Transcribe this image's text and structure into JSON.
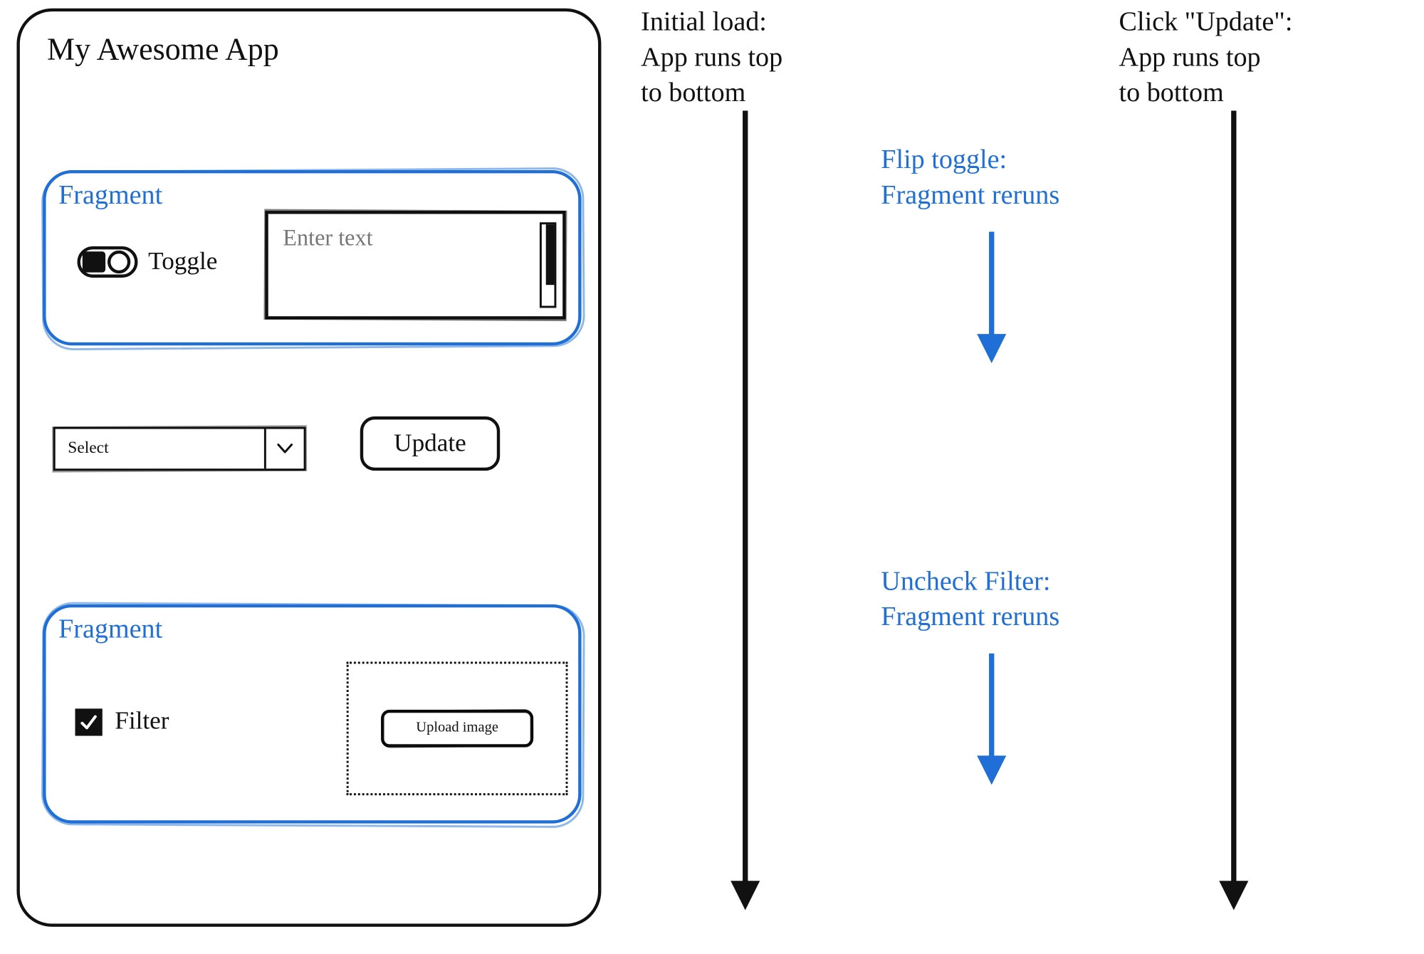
{
  "app": {
    "title": "My Awesome App",
    "fragment1": {
      "heading": "Fragment",
      "toggle_label": "Toggle",
      "text_placeholder": "Enter text"
    },
    "select": {
      "selected": "Select"
    },
    "update_button_label": "Update",
    "fragment2": {
      "heading": "Fragment",
      "filter_label": "Filter",
      "upload_button_label": "Upload image"
    }
  },
  "annotations": {
    "initial_load": "Initial load:\nApp runs top\nto bottom",
    "click_update": "Click \"Update\":\nApp runs top\nto bottom",
    "flip_toggle": "Flip toggle:\nFragment reruns",
    "uncheck_filter": "Uncheck Filter:\nFragment reruns"
  },
  "colors": {
    "accent_blue": "#1f6fd6",
    "ink": "#111111"
  }
}
